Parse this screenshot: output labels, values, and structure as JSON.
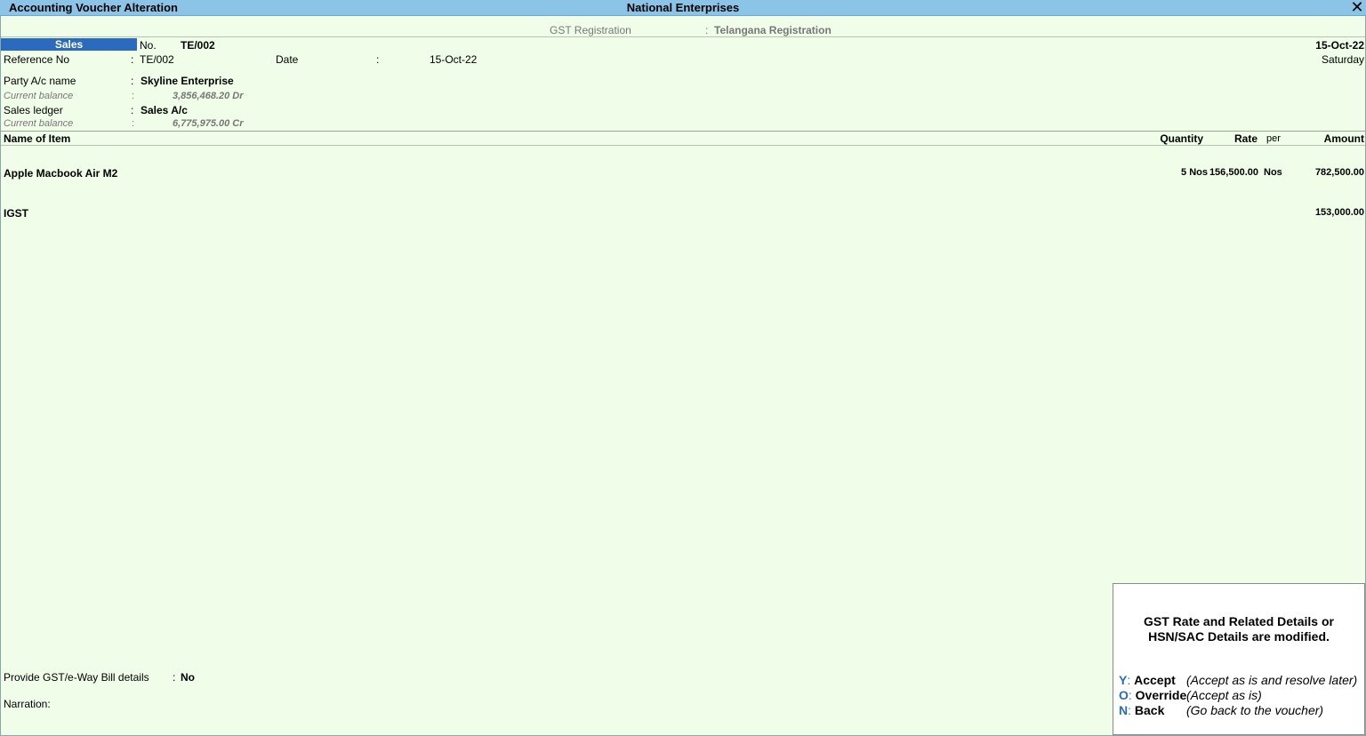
{
  "titlebar": {
    "title": "Accounting Voucher Alteration",
    "company": "National Enterprises",
    "close_glyph": "✕"
  },
  "gst": {
    "label": "GST Registration",
    "sep": ":",
    "value": "Telangana Registration"
  },
  "voucher": {
    "type": "Sales",
    "no_label": "No.",
    "no_value": "TE/002",
    "date_top": "15-Oct-22",
    "day": "Saturday",
    "ref_label": "Reference No",
    "ref_sep": ":",
    "ref_value": "TE/002",
    "date_label": "Date",
    "date_sep": ":",
    "date_value": "15-Oct-22"
  },
  "party": {
    "label": "Party A/c name",
    "sep": ":",
    "value": "Skyline Enterprise",
    "balance_label": "Current balance",
    "balance_sep": ":",
    "balance_value": "3,856,468.20 Dr"
  },
  "sales_ledger": {
    "label": "Sales ledger",
    "sep": ":",
    "value": "Sales A/c",
    "balance_label": "Current balance",
    "balance_sep": ":",
    "balance_value": "6,775,975.00 Cr"
  },
  "table": {
    "headers": {
      "name": "Name of Item",
      "quantity": "Quantity",
      "rate": "Rate",
      "per": "per",
      "amount": "Amount"
    },
    "items": [
      {
        "name": "Apple Macbook Air M2",
        "quantity": "5 Nos",
        "rate": "156,500.00",
        "per": "Nos",
        "amount": "782,500.00"
      }
    ],
    "tax": {
      "name": "IGST",
      "amount": "153,000.00"
    }
  },
  "footer": {
    "gst_label": "Provide GST/e-Way Bill details",
    "gst_sep": ":",
    "gst_value": "No",
    "narration_label": "Narration:"
  },
  "popup": {
    "message_line1": "GST Rate and Related Details or",
    "message_line2": "HSN/SAC Details are modified.",
    "options": [
      {
        "key": "Y",
        "label": "Accept",
        "desc": "(Accept as is and resolve later)"
      },
      {
        "key": "O",
        "label": "Override",
        "desc": "(Accept as is)"
      },
      {
        "key": "N",
        "label": "Back",
        "desc": "(Go back to the voucher)"
      }
    ]
  },
  "colors": {
    "background": "#f0fde8",
    "titlebar": "#8cc4e8",
    "voucher_type_bg": "#2a6bbf",
    "popup_key": "#2a6bbf"
  }
}
